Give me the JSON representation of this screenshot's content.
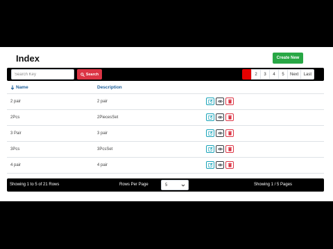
{
  "header": {
    "title": "Index",
    "create_label": "Create New"
  },
  "toolbar": {
    "search_placeholder": "Search Key",
    "search_label": "Search"
  },
  "pagination": {
    "active": "1",
    "pages": [
      "2",
      "3",
      "4",
      "5"
    ],
    "next_label": "Next",
    "last_label": "Last"
  },
  "table": {
    "columns": [
      "Name",
      "Description"
    ],
    "rows": [
      {
        "name": "2 pair",
        "description": "2 pair"
      },
      {
        "name": "2Pcs",
        "description": "2PiecesSet"
      },
      {
        "name": "3 Pair",
        "description": "3 pair"
      },
      {
        "name": "3Pcs",
        "description": "3PcsSet"
      },
      {
        "name": "4 pair",
        "description": "4 pair"
      }
    ]
  },
  "footer": {
    "rows_summary": "Showing 1 to 5 of 21 Rows",
    "rows_per_page_label": "Rows Per Page",
    "rows_per_page_value": "5",
    "pages_summary": "Showing 1 / 5 Pages"
  },
  "colors": {
    "create_button": "#28a745",
    "search_button": "#dc3545",
    "active_page": "#e60000",
    "header_link": "#1f5f99"
  },
  "icons": {
    "search": "search-icon",
    "sort": "arrow-down-icon",
    "edit": "edit-icon",
    "view": "eye-icon",
    "delete": "trash-icon",
    "select": "chevron-down-icon"
  }
}
